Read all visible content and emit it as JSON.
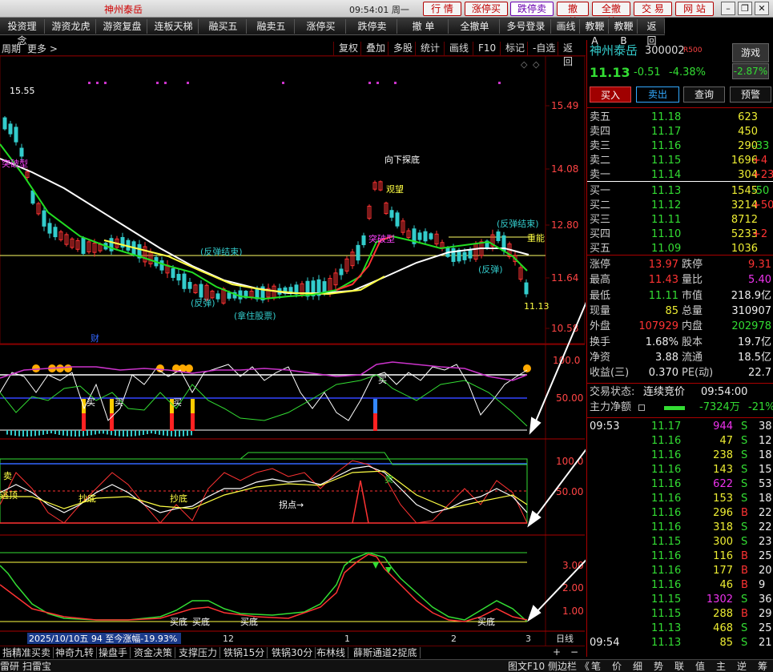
{
  "window": {
    "title": "神州泰岳",
    "clock": "09:54:01 周一",
    "nav_buttons": [
      "行 情",
      "涨停买",
      "跌停卖",
      "撤 单",
      "全撤单",
      "交 易",
      "网 站"
    ]
  },
  "toolbar": {
    "items": [
      "投资理念",
      "游资龙虎",
      "游资复盘",
      "连板天梯",
      "融买五",
      "融卖五",
      "涨停买",
      "跌停卖",
      "撤 单",
      "全撤单",
      "多号登录",
      "画线",
      "教鞭A",
      "教鞭B",
      "返回"
    ]
  },
  "chart_header": {
    "period": "周期",
    "more": "更多 >",
    "buttons": [
      "复权",
      "叠加",
      "多股",
      "统计",
      "画线",
      "F10",
      "标记",
      "-自选",
      "返回"
    ]
  },
  "price_chart": {
    "y_ticks": [
      "15.49",
      "14.08",
      "12.80",
      "11.64",
      "10.58"
    ],
    "high_label": "15.55",
    "low_label": "11.13",
    "annotations": [
      "突破型",
      "(反弹结束)",
      "(反弹)",
      "(拿住股票)",
      "财",
      "向下探底",
      "观望",
      "突破型",
      "(反弹结束)",
      "(反弹)",
      "重能"
    ]
  },
  "indicator1": {
    "y_ticks": [
      "100.0",
      "50.00"
    ],
    "labels": [
      "买",
      "买",
      "买",
      "买"
    ]
  },
  "indicator2": {
    "y_ticks": [
      "100.0",
      "50.00"
    ],
    "labels": [
      "卖",
      "逃顶",
      "抄底",
      "抄底",
      "拐点→",
      "卖"
    ]
  },
  "indicator3": {
    "y_ticks": [
      "3.00",
      "2.00",
      "1.00"
    ],
    "labels": [
      "买底",
      "买底",
      "买底",
      "买底"
    ]
  },
  "time_axis": {
    "labels": [
      "1",
      "12",
      "1",
      "2",
      "3"
    ],
    "range_text": "2025/10/10五 94 至今涨幅-19.93%",
    "period_label": "日线"
  },
  "quote": {
    "name": "神州泰岳",
    "code": "300002",
    "badge": "R500",
    "game_button": "游戏",
    "price": "11.13",
    "change": "-0.51",
    "change_pct": "-4.38%",
    "side_pct": "-2.87%",
    "actions": [
      "买入",
      "卖出",
      "查询",
      "预警"
    ],
    "asks": [
      {
        "label": "卖五",
        "price": "11.18",
        "vol": "623",
        "delta": ""
      },
      {
        "label": "卖四",
        "price": "11.17",
        "vol": "450",
        "delta": ""
      },
      {
        "label": "卖三",
        "price": "11.16",
        "vol": "290",
        "delta": "-33"
      },
      {
        "label": "卖二",
        "price": "11.15",
        "vol": "1696",
        "delta": "+4"
      },
      {
        "label": "卖一",
        "price": "11.14",
        "vol": "304",
        "delta": "+239"
      }
    ],
    "bids": [
      {
        "label": "买一",
        "price": "11.13",
        "vol": "1545",
        "delta": "-50"
      },
      {
        "label": "买二",
        "price": "11.12",
        "vol": "3214",
        "delta": "+50"
      },
      {
        "label": "买三",
        "price": "11.11",
        "vol": "8712",
        "delta": ""
      },
      {
        "label": "买四",
        "price": "11.10",
        "vol": "5233",
        "delta": "+2"
      },
      {
        "label": "买五",
        "price": "11.09",
        "vol": "1036",
        "delta": ""
      }
    ],
    "stats": [
      {
        "l1": "涨停",
        "v1": "13.97",
        "l2": "跌停",
        "v2": "9.31"
      },
      {
        "l1": "最高",
        "v1": "11.43",
        "l2": "量比",
        "v2": "5.40"
      },
      {
        "l1": "最低",
        "v1": "11.11",
        "l2": "市值",
        "v2": "218.9亿"
      },
      {
        "l1": "现量",
        "v1": "85",
        "l2": "总量",
        "v2": "310907"
      },
      {
        "l1": "外盘",
        "v1": "107929",
        "l2": "内盘",
        "v2": "202978"
      },
      {
        "l1": "换手",
        "v1": "1.68%",
        "l2": "股本",
        "v2": "19.7亿"
      },
      {
        "l1": "净资",
        "v1": "3.88",
        "l2": "流通",
        "v2": "18.5亿"
      },
      {
        "l1": "收益(三)",
        "v1": "0.370",
        "l2": "PE(动)",
        "v2": "22.7"
      }
    ],
    "trade_status_label": "交易状态:",
    "trade_status": "连续竞价",
    "trade_time": "09:54:00",
    "main_flow_label": "主力净额",
    "main_flow": "-7324万",
    "main_flow_pct": "-21%",
    "ticks_time_start": "09:53",
    "ticks_time_end": "09:54",
    "ticks": [
      {
        "p": "11.17",
        "v": "944",
        "s": "S",
        "n": "38"
      },
      {
        "p": "11.16",
        "v": "47",
        "s": "S",
        "n": "12"
      },
      {
        "p": "11.16",
        "v": "238",
        "s": "S",
        "n": "18"
      },
      {
        "p": "11.16",
        "v": "143",
        "s": "S",
        "n": "15"
      },
      {
        "p": "11.16",
        "v": "622",
        "s": "S",
        "n": "53"
      },
      {
        "p": "11.16",
        "v": "153",
        "s": "S",
        "n": "18"
      },
      {
        "p": "11.16",
        "v": "296",
        "s": "B",
        "n": "22"
      },
      {
        "p": "11.16",
        "v": "318",
        "s": "S",
        "n": "22"
      },
      {
        "p": "11.15",
        "v": "300",
        "s": "S",
        "n": "23"
      },
      {
        "p": "11.16",
        "v": "116",
        "s": "B",
        "n": "25"
      },
      {
        "p": "11.16",
        "v": "177",
        "s": "B",
        "n": "20"
      },
      {
        "p": "11.16",
        "v": "46",
        "s": "B",
        "n": "9"
      },
      {
        "p": "11.15",
        "v": "1302",
        "s": "S",
        "n": "36"
      },
      {
        "p": "11.15",
        "v": "288",
        "s": "B",
        "n": "29"
      },
      {
        "p": "11.13",
        "v": "468",
        "s": "S",
        "n": "25"
      },
      {
        "p": "11.13",
        "v": "85",
        "s": "S",
        "n": "21"
      }
    ]
  },
  "bottom_tabs": [
    "指",
    "精准买卖",
    "神奇九转",
    "操盘手",
    "资金决策",
    "支撑压力",
    "铁锅15分",
    "铁锅30分",
    "布林线",
    "薛斯通道2捉底"
  ],
  "status_bar": {
    "left": [
      "雷研",
      "扫雷宝"
    ],
    "right": [
      "图文F10",
      "侧边栏 《"
    ],
    "right_tabs": [
      "笔",
      "价",
      "细",
      "势",
      "联",
      "值",
      "主",
      "逆",
      "筹"
    ]
  },
  "colors": {
    "up": "#ff3333",
    "down": "#33dd33",
    "accent": "#a00000",
    "ma_white": "#ffffff",
    "ma_yellow": "#ffff44",
    "ma_green": "#22dd22"
  }
}
